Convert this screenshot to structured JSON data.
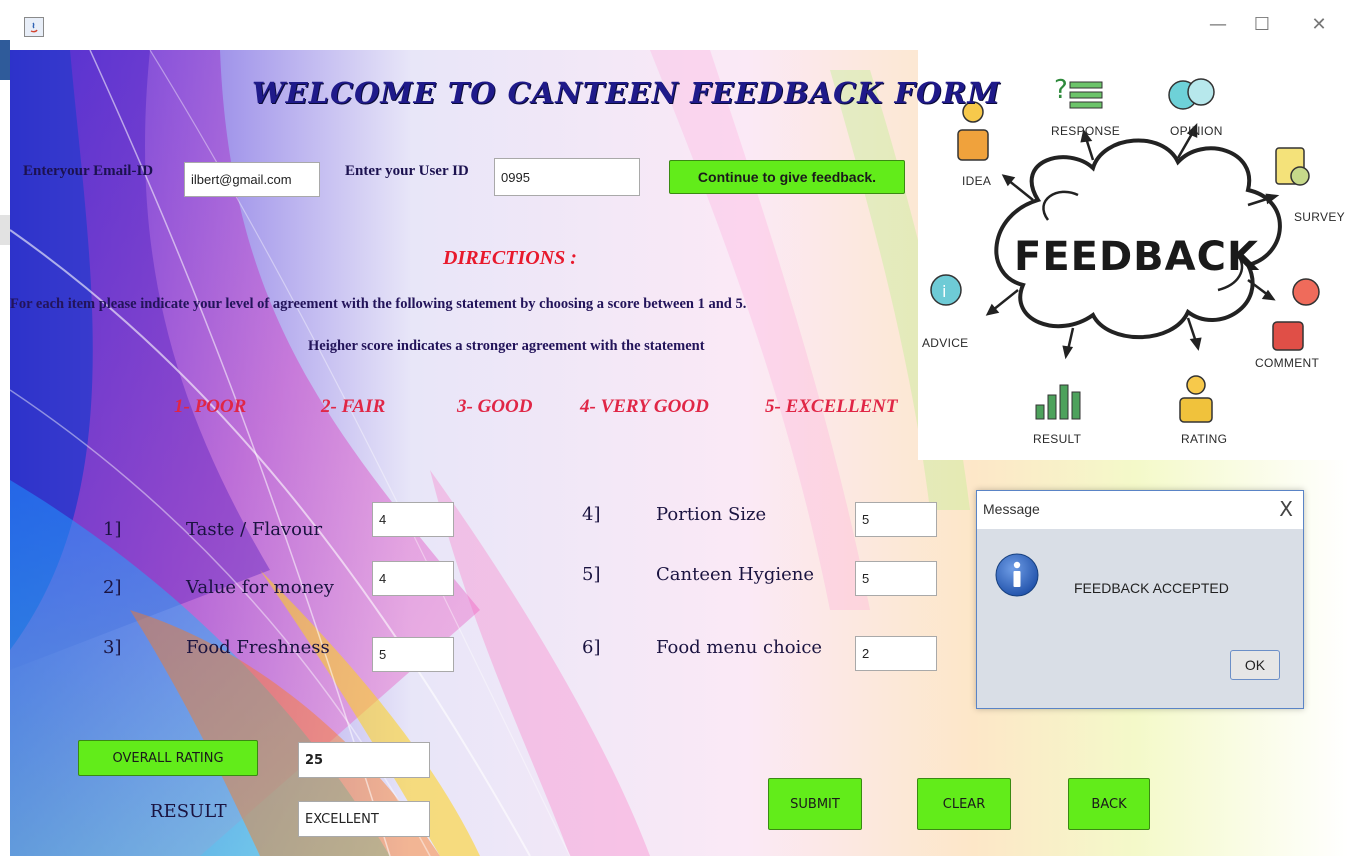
{
  "window": {
    "controls": {
      "minimize": "—",
      "maximize": "☐",
      "close": "✕"
    }
  },
  "header": {
    "title": "WELCOME TO CANTEEN FEEDBACK FORM"
  },
  "login": {
    "email_label": "Enteryour Email-ID",
    "email_value": "ilbert@gmail.com",
    "userid_label": "Enter your User ID",
    "userid_value": "0995",
    "continue_label": "Continue to give feedback."
  },
  "directions": {
    "heading": "DIRECTIONS :",
    "line1": "For each item please indicate your level of agreement with the following statement by choosing a score between 1 and 5.",
    "line2": "Heigher score indicates a stronger agreement with the statement"
  },
  "scale": [
    "1- POOR",
    "2- FAIR",
    "3- GOOD",
    "4- VERY GOOD",
    "5- EXCELLENT"
  ],
  "questions": [
    {
      "num": "1]",
      "text": "Taste / Flavour",
      "value": "4"
    },
    {
      "num": "2]",
      "text": "Value for money",
      "value": "4"
    },
    {
      "num": "3]",
      "text": "Food Freshness",
      "value": "5"
    },
    {
      "num": "4]",
      "text": "Portion Size",
      "value": "5"
    },
    {
      "num": "5]",
      "text": "Canteen Hygiene",
      "value": "5"
    },
    {
      "num": "6]",
      "text": "Food menu choice",
      "value": "2"
    }
  ],
  "summary": {
    "overall_button": "OVERALL RATING",
    "overall_value": "25",
    "result_label": "RESULT",
    "result_value": "EXCELLENT"
  },
  "actions": {
    "submit": "SUBMIT",
    "clear": "CLEAR",
    "back": "BACK"
  },
  "graphic": {
    "center": "FEEDBACK",
    "labels": [
      "IDEA",
      "RESPONSE",
      "OPINION",
      "SURVEY",
      "COMMENT",
      "RATING",
      "RESULT",
      "ADVICE"
    ]
  },
  "dialog": {
    "title": "Message",
    "message": "FEEDBACK ACCEPTED",
    "ok": "OK",
    "close": "X"
  }
}
